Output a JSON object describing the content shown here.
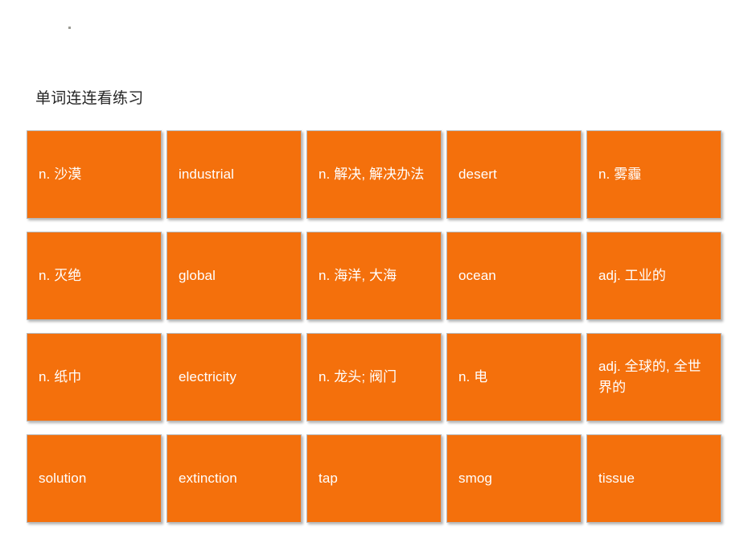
{
  "slide": {
    "title": "单词连连看练习",
    "corner_mark": "bullet-dot",
    "background_color": "#ffffff",
    "title_color": "#262626"
  },
  "tile_style": {
    "fill_color": "#F4700C",
    "text_color": "#ffffff",
    "border_color": "#b7b7b7"
  },
  "grid": {
    "columns": 5,
    "rows": 4,
    "tiles": [
      {
        "text": "n. 沙漠",
        "lang": "zh"
      },
      {
        "text": "industrial",
        "lang": "en"
      },
      {
        "text": "n. 解决, 解决办法",
        "lang": "zh"
      },
      {
        "text": "desert",
        "lang": "en"
      },
      {
        "text": "n. 雾霾",
        "lang": "zh"
      },
      {
        "text": "n. 灭绝",
        "lang": "zh"
      },
      {
        "text": "global",
        "lang": "en"
      },
      {
        "text": "n. 海洋, 大海",
        "lang": "zh"
      },
      {
        "text": "ocean",
        "lang": "en"
      },
      {
        "text": "adj. 工业的",
        "lang": "zh"
      },
      {
        "text": "n. 纸巾",
        "lang": "zh"
      },
      {
        "text": "electricity",
        "lang": "en"
      },
      {
        "text": "n. 龙头; 阀门",
        "lang": "zh"
      },
      {
        "text": "n. 电",
        "lang": "zh"
      },
      {
        "text": "adj. 全球的, 全世界的",
        "lang": "zh"
      },
      {
        "text": "solution",
        "lang": "en"
      },
      {
        "text": "extinction",
        "lang": "en"
      },
      {
        "text": "tap",
        "lang": "en"
      },
      {
        "text": "smog",
        "lang": "en"
      },
      {
        "text": "tissue",
        "lang": "en"
      }
    ]
  }
}
